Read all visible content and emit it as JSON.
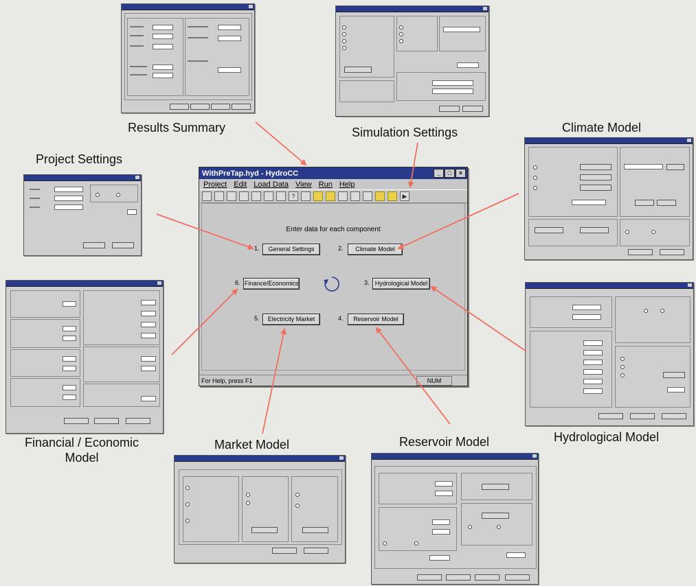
{
  "main_window": {
    "title": "WithPreTap.hyd - HydroCC",
    "menu": [
      "Project",
      "Edit",
      "Load Data",
      "View",
      "Run",
      "Help"
    ],
    "instruction": "Enter data for each component",
    "buttons": [
      {
        "num": "1.",
        "label": "General Settings"
      },
      {
        "num": "2.",
        "label": "Climate Model"
      },
      {
        "num": "3.",
        "label": "Hydrological Model"
      },
      {
        "num": "4.",
        "label": "Reservoir Model"
      },
      {
        "num": "5.",
        "label": "Electricity Market"
      },
      {
        "num": "6.",
        "label": "Finance/Economics"
      }
    ],
    "status_text": "For Help, press F1",
    "status_indicator": "NUM"
  },
  "captions": {
    "results_summary": "Results Summary",
    "simulation_settings": "Simulation Settings",
    "climate_model": "Climate Model",
    "project_settings": "Project Settings",
    "financial_economic_model": "Financial / Economic Model",
    "market_model": "Market Model",
    "reservoir_model": "Reservoir Model",
    "hydrological_model": "Hydrological Model"
  },
  "colors": {
    "arrow": "#f07060",
    "titlebar": "#2a3a8a",
    "background": "#e9e9e6"
  },
  "icons": {
    "cycle": "refresh-cycle-icon"
  }
}
